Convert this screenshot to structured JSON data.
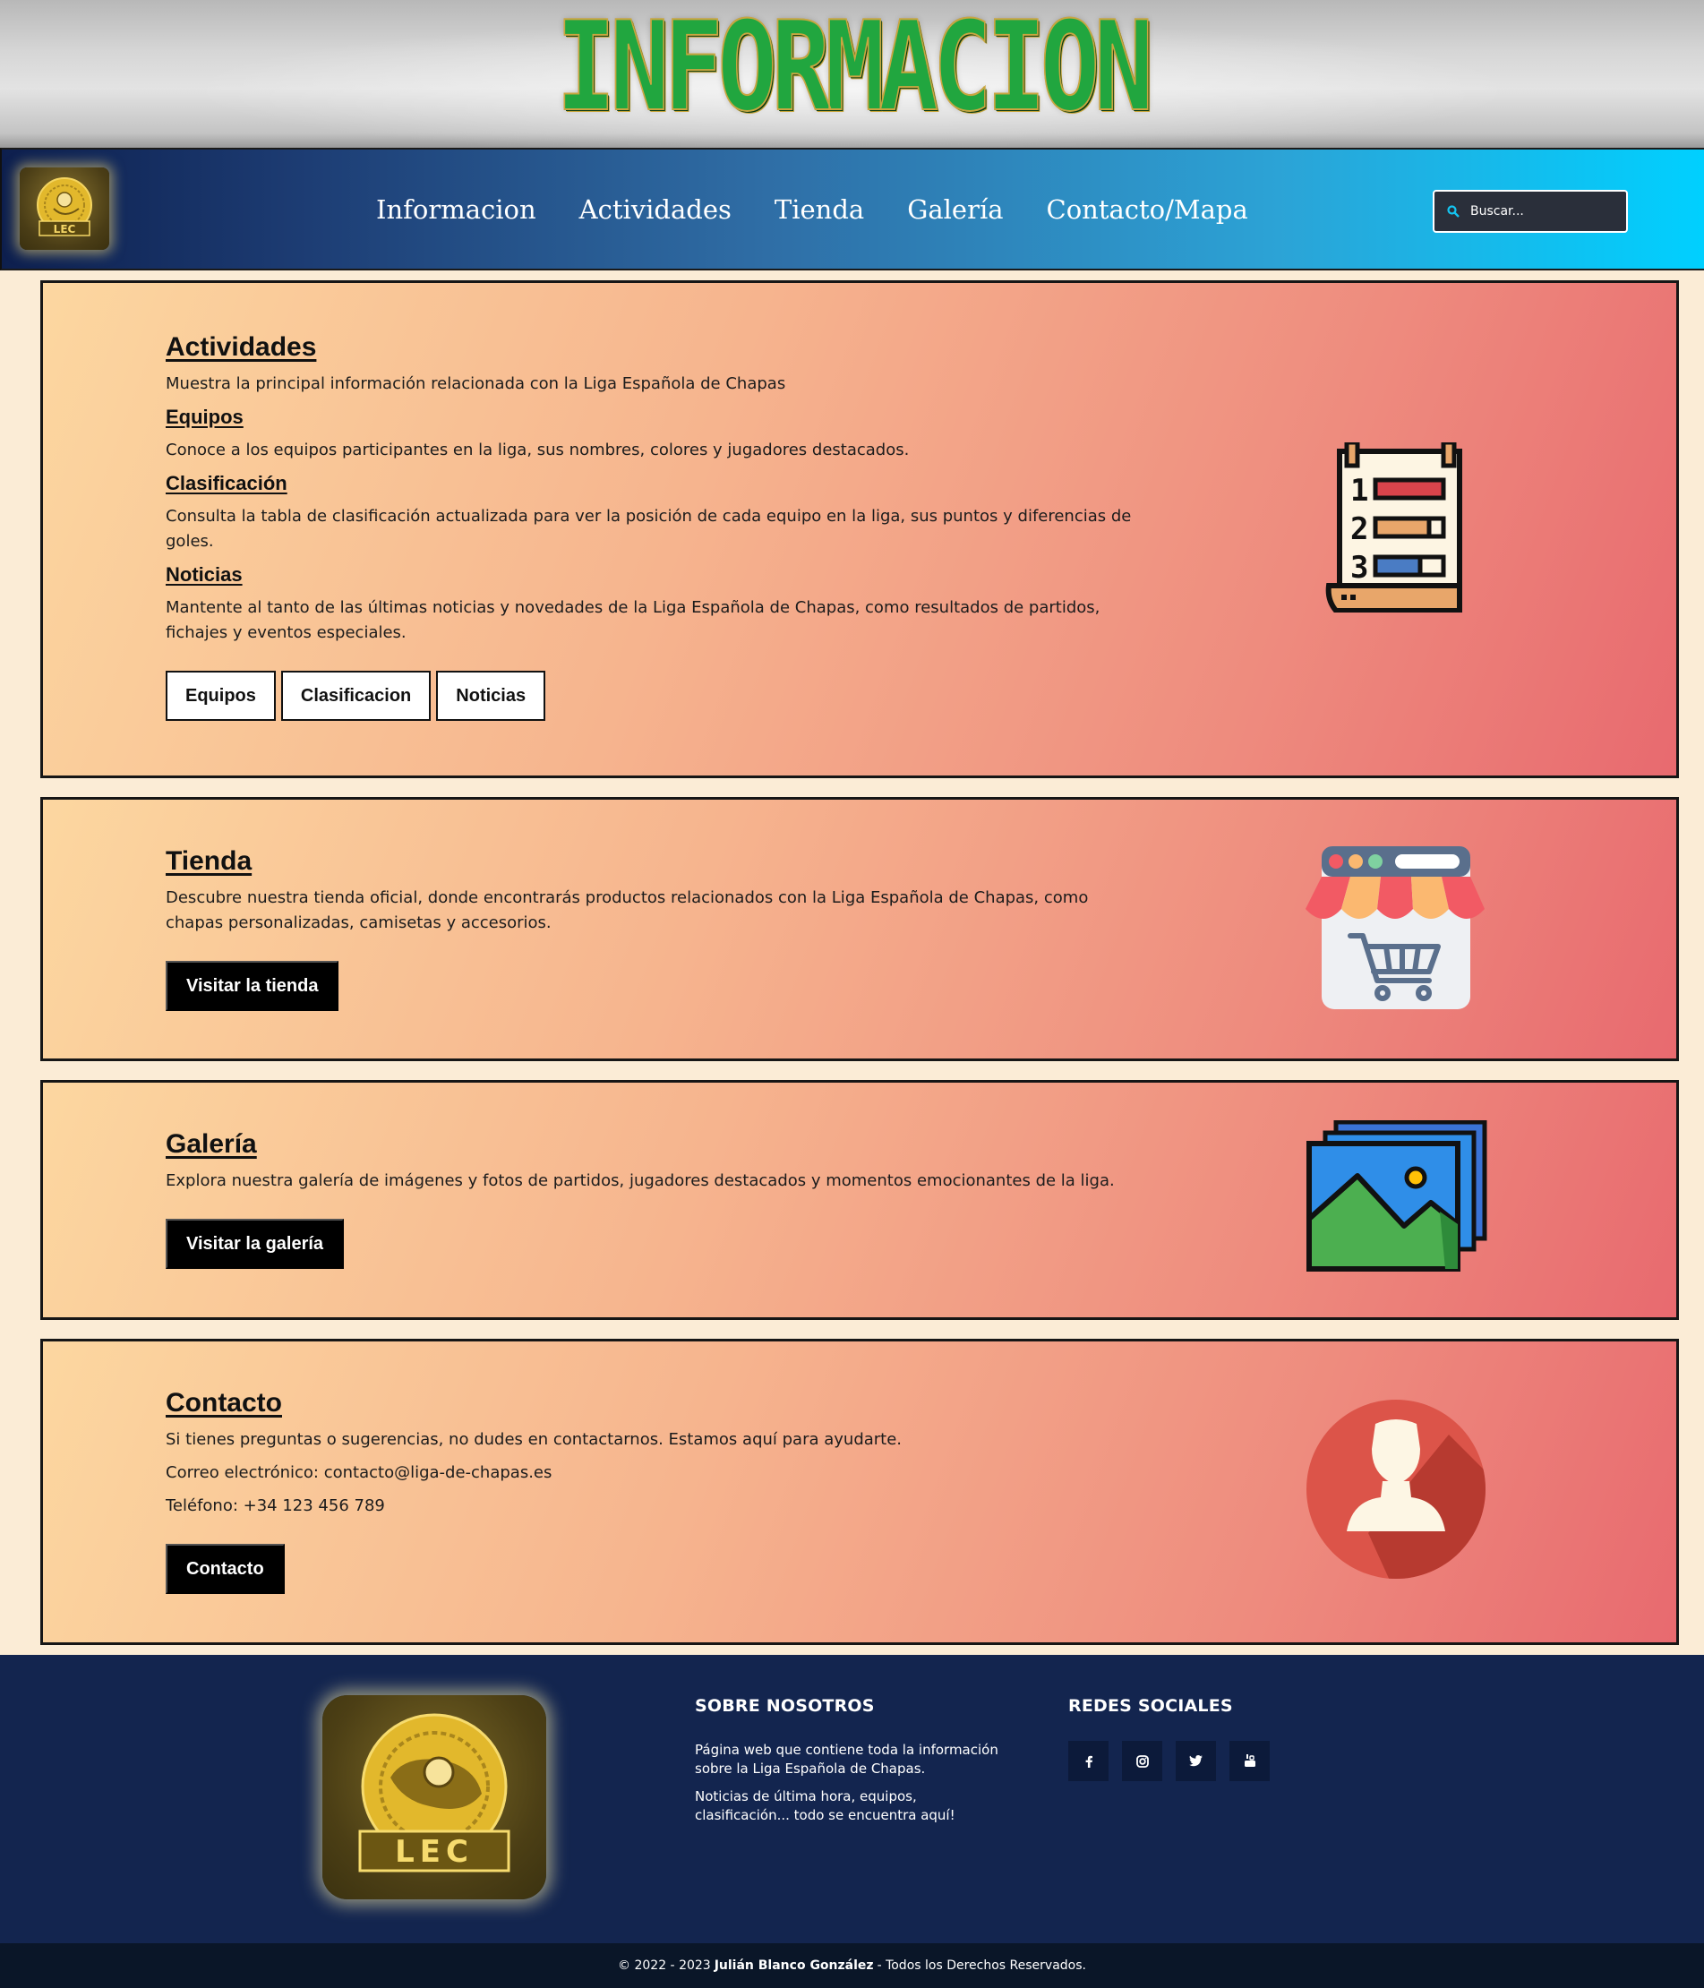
{
  "banner": {
    "title": "INFORMACION"
  },
  "nav": {
    "logo_text": "LEC",
    "links": [
      "Informacion",
      "Actividades",
      "Tienda",
      "Galería",
      "Contacto/Mapa"
    ],
    "search_placeholder": "Buscar..."
  },
  "actividades": {
    "title": "Actividades",
    "intro": "Muestra la principal información relacionada con la Liga Española de Chapas",
    "sub": [
      {
        "title": "Equipos",
        "text": "Conoce a los equipos participantes en la liga, sus nombres, colores y jugadores destacados."
      },
      {
        "title": "Clasificación",
        "text": "Consulta la tabla de clasificación actualizada para ver la posición de cada equipo en la liga, sus puntos y diferencias de goles."
      },
      {
        "title": "Noticias",
        "text": "Mantente al tanto de las últimas noticias y novedades de la Liga Española de Chapas, como resultados de partidos, fichajes y eventos especiales."
      }
    ],
    "buttons": [
      "Equipos",
      "Clasificacion",
      "Noticias"
    ],
    "icon_digits": [
      "1",
      "2",
      "3"
    ]
  },
  "tienda": {
    "title": "Tienda",
    "text": "Descubre nuestra tienda oficial, donde encontrarás productos relacionados con la Liga Española de Chapas, como chapas personalizadas, camisetas y accesorios.",
    "button": "Visitar la tienda"
  },
  "galeria": {
    "title": "Galería",
    "text": "Explora nuestra galería de imágenes y fotos de partidos, jugadores destacados y momentos emocionantes de la liga.",
    "button": "Visitar la galería"
  },
  "contacto": {
    "title": "Contacto",
    "text": "Si tienes preguntas o sugerencias, no dudes en contactarnos. Estamos aquí para ayudarte.",
    "email": "Correo electrónico: contacto@liga-de-chapas.es",
    "phone": "Teléfono: +34 123 456 789",
    "button": "Contacto"
  },
  "footer": {
    "logo_text": "LEC",
    "about_title": "SOBRE NOSOTROS",
    "about_p1": "Página web que contiene toda la información sobre la Liga Española de Chapas.",
    "about_p2": "Noticias de última hora, equipos, clasificación... todo se encuentra aquí!",
    "social_title": "REDES SOCIALES",
    "social": [
      "f",
      "instagram",
      "twitter",
      "youtube"
    ],
    "copyright_pre": "© 2022 - 2023",
    "copyright_name": "Julián Blanco González",
    "copyright_post": "- Todos los Derechos Reservados."
  },
  "colors": {
    "nav_start": "#0d1f4e",
    "nav_end": "#00d0ff",
    "card_start": "#fcd7a0",
    "card_end": "#e86a6f",
    "footer_bg": "#13254f",
    "title_green": "#21a63f"
  }
}
